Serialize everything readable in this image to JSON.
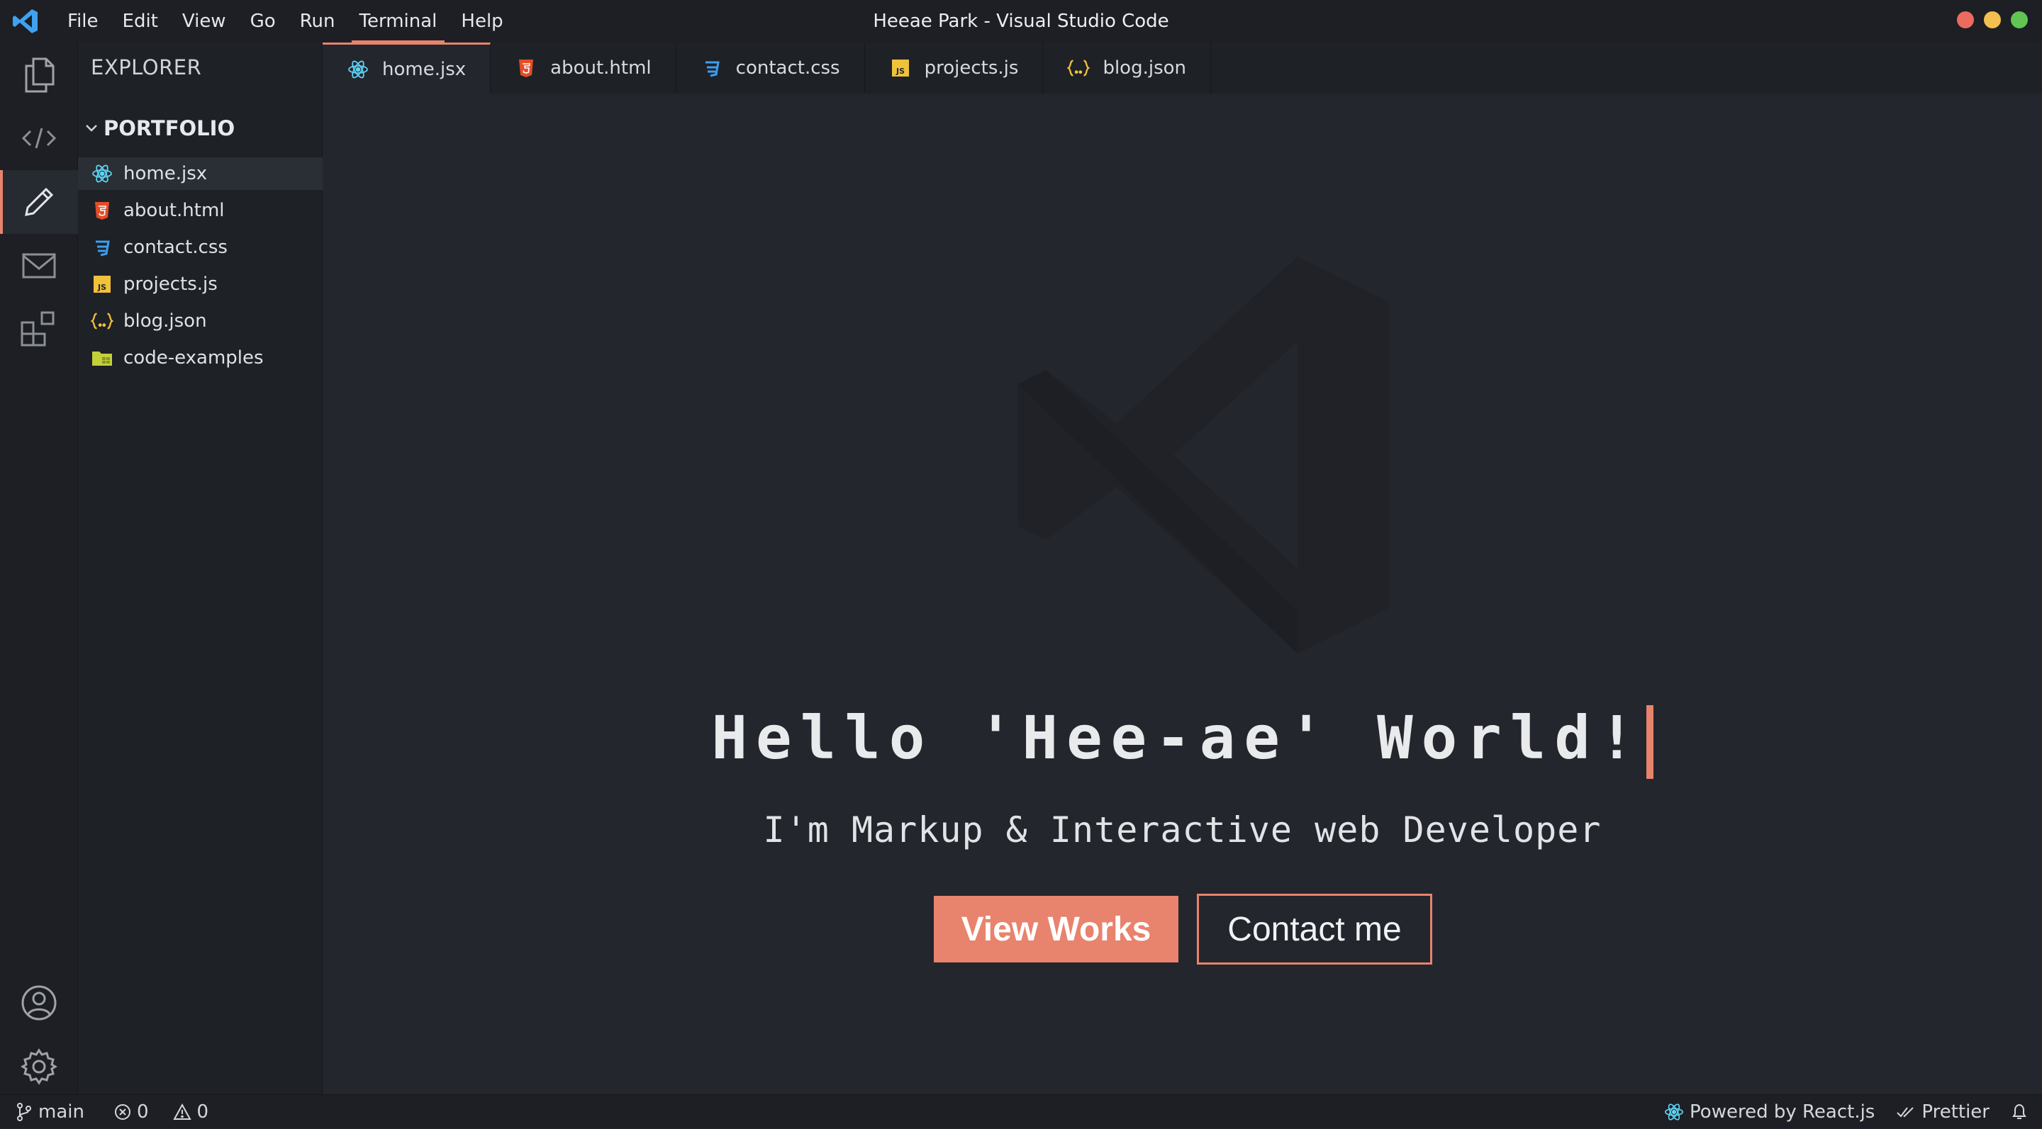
{
  "window": {
    "title": "Heeae Park - Visual Studio Code",
    "traffic_colors": [
      "#ec6a5e",
      "#f4bf4f",
      "#61c554"
    ]
  },
  "menu": [
    "File",
    "Edit",
    "View",
    "Go",
    "Run",
    "Terminal",
    "Help"
  ],
  "activity_bar": {
    "items": [
      "files-icon",
      "code-icon",
      "pencil-icon",
      "mail-icon",
      "extensions-icon"
    ],
    "bottom": [
      "account-icon",
      "gear-icon"
    ]
  },
  "sidebar": {
    "title": "EXPLORER",
    "folder": "PORTFOLIO",
    "files": [
      {
        "name": "home.jsx",
        "icon": "react-icon"
      },
      {
        "name": "about.html",
        "icon": "html5-icon"
      },
      {
        "name": "contact.css",
        "icon": "css3-icon"
      },
      {
        "name": "projects.js",
        "icon": "js-icon"
      },
      {
        "name": "blog.json",
        "icon": "json-icon"
      },
      {
        "name": "code-examples",
        "icon": "folder-icon"
      }
    ]
  },
  "tabs": [
    {
      "label": "home.jsx",
      "icon": "react-icon"
    },
    {
      "label": "about.html",
      "icon": "html5-icon"
    },
    {
      "label": "contact.css",
      "icon": "css3-icon"
    },
    {
      "label": "projects.js",
      "icon": "js-icon"
    },
    {
      "label": "blog.json",
      "icon": "json-icon"
    }
  ],
  "hero": {
    "headline": "Hello 'Hee-ae' World!",
    "subtitle": "I'm Markup & Interactive web Developer",
    "primary_button": "View Works",
    "secondary_button": "Contact me"
  },
  "status_bar": {
    "branch": "main",
    "errors": "0",
    "warnings": "0",
    "powered_by": "Powered by React.js",
    "formatter": "Prettier"
  },
  "colors": {
    "accent": "#e8836d",
    "react": "#5ed3f3",
    "html": "#e44d26",
    "css": "#3c9ff0",
    "js": "#f0c23a",
    "json": "#f0c23a"
  }
}
